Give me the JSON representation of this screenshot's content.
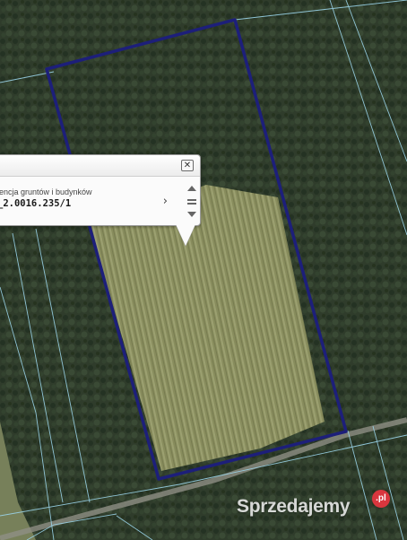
{
  "map": {
    "colors": {
      "forest": "#2c3a29",
      "field": "#8f9361",
      "parcel_outline": "#1d1f7a",
      "cadastral_lines": "#9ad3e8",
      "road": "#9a9a8f"
    }
  },
  "popup": {
    "layer_name": "lencja gruntów i budynków",
    "parcel_id": "_2.0016.235/1",
    "close_icon": "close-icon",
    "next_icon": "chevron-right-icon"
  },
  "watermark": {
    "text": "Sprzedajemy",
    "badge": ".pl"
  }
}
